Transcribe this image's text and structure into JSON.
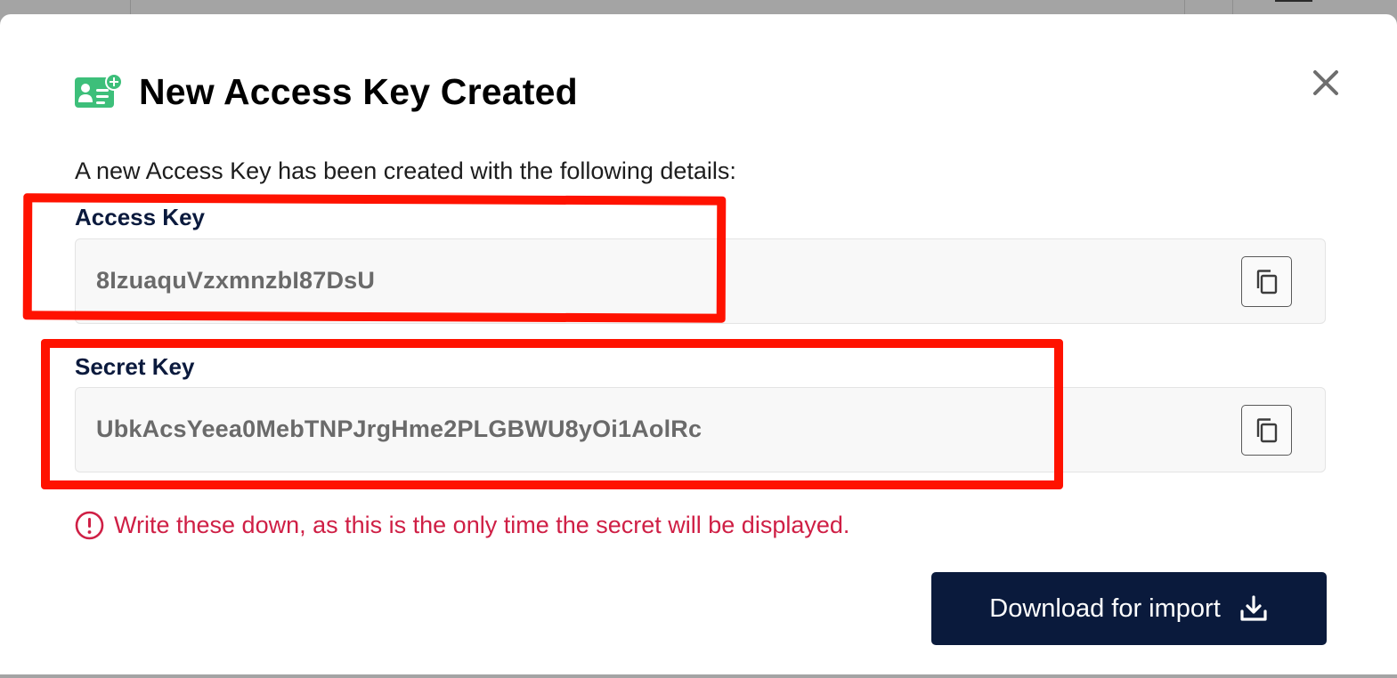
{
  "dialog": {
    "title": "New Access Key Created",
    "intro": "A new Access Key has been created with the following details:",
    "title_icon": "id-card-plus-icon",
    "accent_color": "#3dbf7a"
  },
  "fields": {
    "access_key": {
      "label": "Access Key",
      "value": "8IzuaquVzxmnzbI87DsU",
      "copy_icon": "copy-icon"
    },
    "secret_key": {
      "label": "Secret Key",
      "value": "UbkAcsYeea0MebTNPJrgHme2PLGBWU8yOi1AolRc",
      "copy_icon": "copy-icon"
    }
  },
  "warning": {
    "text": "Write these down, as this is the only time the secret will be displayed.",
    "icon": "exclamation-circle-icon",
    "color": "#cf1f45"
  },
  "actions": {
    "download_label": "Download for import",
    "download_icon": "download-icon",
    "close_icon": "close-icon"
  },
  "colors": {
    "primary_button": "#0a1a3c",
    "highlight_annotation": "#ff1200",
    "label": "#0b1a3d"
  }
}
